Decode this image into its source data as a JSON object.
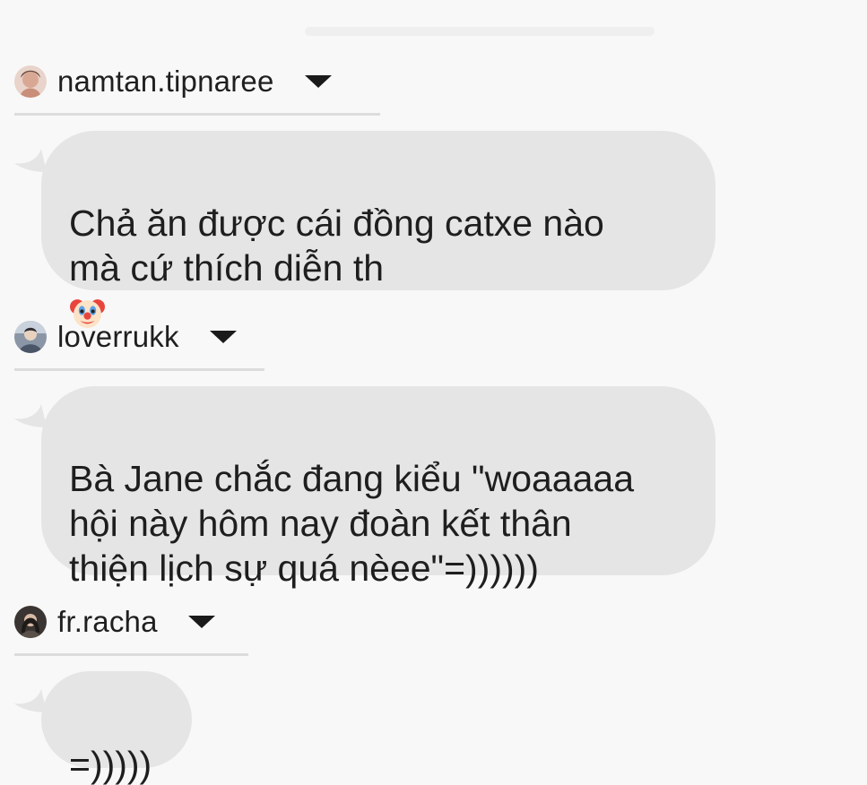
{
  "comments": [
    {
      "username": "namtan.tipnaree",
      "text_main": "Chả ăn được cái đồng catxe nào\nmà cứ thích diễn th",
      "emoji": "clown-face-emoji"
    },
    {
      "username": "loverrukk",
      "text_main": "Bà Jane chắc đang kiểu \"woaaaaa\nhội này hôm nay đoàn kết thân\nthiện lịch sự quá nèee\"=))))))"
    },
    {
      "username": "fr.racha",
      "text_main": "=)))))"
    }
  ],
  "icons": {
    "dropdown": "caret-down-icon",
    "tail": "speech-tail-icon"
  },
  "colors": {
    "background": "#f8f8f8",
    "bubble": "#e5e5e5",
    "text": "#1e1e1e",
    "divider": "#dcdcdc"
  }
}
